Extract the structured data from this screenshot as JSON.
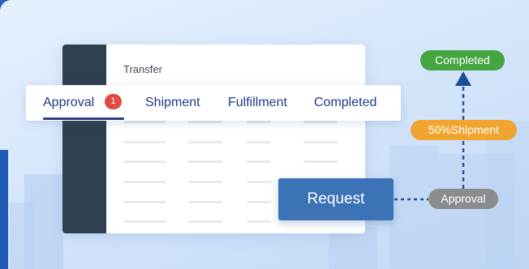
{
  "window": {
    "title": "Transfer"
  },
  "tabs": [
    {
      "label": "Approval",
      "badge": "1",
      "active": true
    },
    {
      "label": "Shipment"
    },
    {
      "label": "Fulfillment"
    },
    {
      "label": "Completed"
    }
  ],
  "request_label": "Request",
  "flow": {
    "completed": "Completed",
    "partial_shipment": "50%Shipment",
    "approval": "Approval"
  },
  "colors": {
    "completed": "#46a543",
    "shipment": "#f1a531",
    "approval": "#8a8c8f",
    "request": "#3c73b7",
    "badge": "#e04a43",
    "tab_text": "#1f3a8a"
  }
}
